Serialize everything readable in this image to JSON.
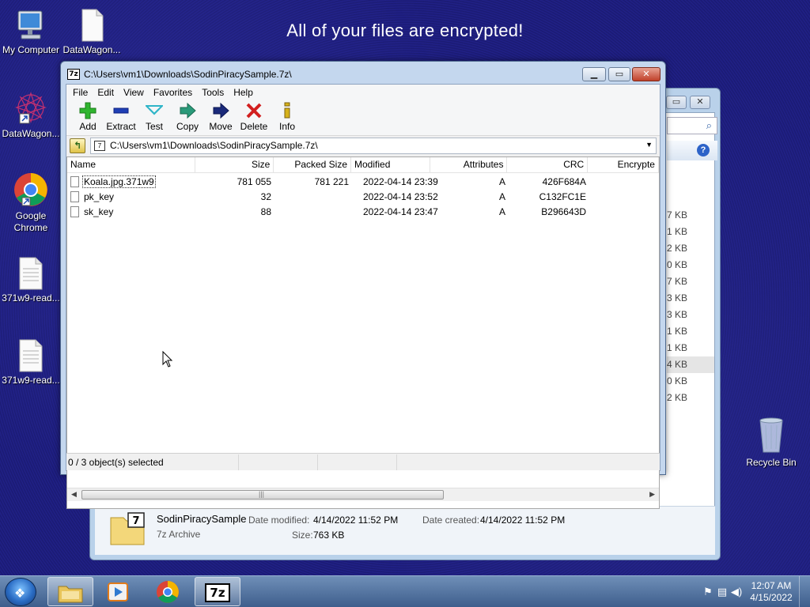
{
  "ransom_message": "All of your files are encrypted!",
  "desktop": {
    "icons": [
      {
        "label": "My Computer",
        "icon": "computer-icon"
      },
      {
        "label": "DataWagon...",
        "icon": "document-icon"
      },
      {
        "label": "DataWagon...",
        "icon": "datawagon-shortcut-icon"
      },
      {
        "label": "Google Chrome",
        "icon": "chrome-icon"
      },
      {
        "label": "371w9-read...",
        "icon": "text-file-icon"
      },
      {
        "label": "371w9-read...",
        "icon": "text-file-icon"
      },
      {
        "label": "Recycle Bin",
        "icon": "recycle-bin-icon"
      }
    ]
  },
  "explorer": {
    "sizes": [
      "7 KB",
      "1 KB",
      "2 KB",
      "0 KB",
      "7 KB",
      "3 KB",
      "3 KB",
      "1 KB",
      "1 KB",
      "4 KB",
      "0 KB",
      "2 KB"
    ],
    "details": {
      "name": "SodinPiracySample",
      "type": "7z Archive",
      "modified_label": "Date modified:",
      "modified_value": "4/14/2022 11:52 PM",
      "created_label": "Date created:",
      "created_value": "4/14/2022 11:52 PM",
      "size_label": "Size:",
      "size_value": "763 KB"
    }
  },
  "sevenzip": {
    "title": "C:\\Users\\vm1\\Downloads\\SodinPiracySample.7z\\",
    "menu": [
      "File",
      "Edit",
      "View",
      "Favorites",
      "Tools",
      "Help"
    ],
    "toolbar": [
      {
        "label": "Add",
        "icon": "add-icon",
        "color": "#2fb52f"
      },
      {
        "label": "Extract",
        "icon": "extract-icon",
        "color": "#1f3fb5"
      },
      {
        "label": "Test",
        "icon": "test-icon",
        "color": "#2fb5c8"
      },
      {
        "label": "Copy",
        "icon": "copy-icon",
        "color": "#2a9a7a"
      },
      {
        "label": "Move",
        "icon": "move-icon",
        "color": "#1a2a7a"
      },
      {
        "label": "Delete",
        "icon": "delete-icon",
        "color": "#d21f1f"
      },
      {
        "label": "Info",
        "icon": "info-icon",
        "color": "#d6b21a"
      }
    ],
    "address": "C:\\Users\\vm1\\Downloads\\SodinPiracySample.7z\\",
    "columns": [
      "Name",
      "Size",
      "Packed Size",
      "Modified",
      "Attributes",
      "CRC",
      "Encrypte"
    ],
    "rows": [
      {
        "name": "Koala.jpg.371w9",
        "size": "781 055",
        "packed": "781 221",
        "modified": "2022-04-14 23:39",
        "attr": "A",
        "crc": "426F684A",
        "enc": ""
      },
      {
        "name": "pk_key",
        "size": "32",
        "packed": "",
        "modified": "2022-04-14 23:52",
        "attr": "A",
        "crc": "C132FC1E",
        "enc": ""
      },
      {
        "name": "sk_key",
        "size": "88",
        "packed": "",
        "modified": "2022-04-14 23:47",
        "attr": "A",
        "crc": "B296643D",
        "enc": ""
      }
    ],
    "status": "0 / 3 object(s) selected"
  },
  "taskbar": {
    "items": [
      {
        "icon": "explorer-icon"
      },
      {
        "icon": "media-player-icon"
      },
      {
        "icon": "chrome-icon"
      },
      {
        "icon": "7zip-icon",
        "label": "7z"
      }
    ],
    "time": "12:07 AM",
    "date": "4/15/2022"
  }
}
